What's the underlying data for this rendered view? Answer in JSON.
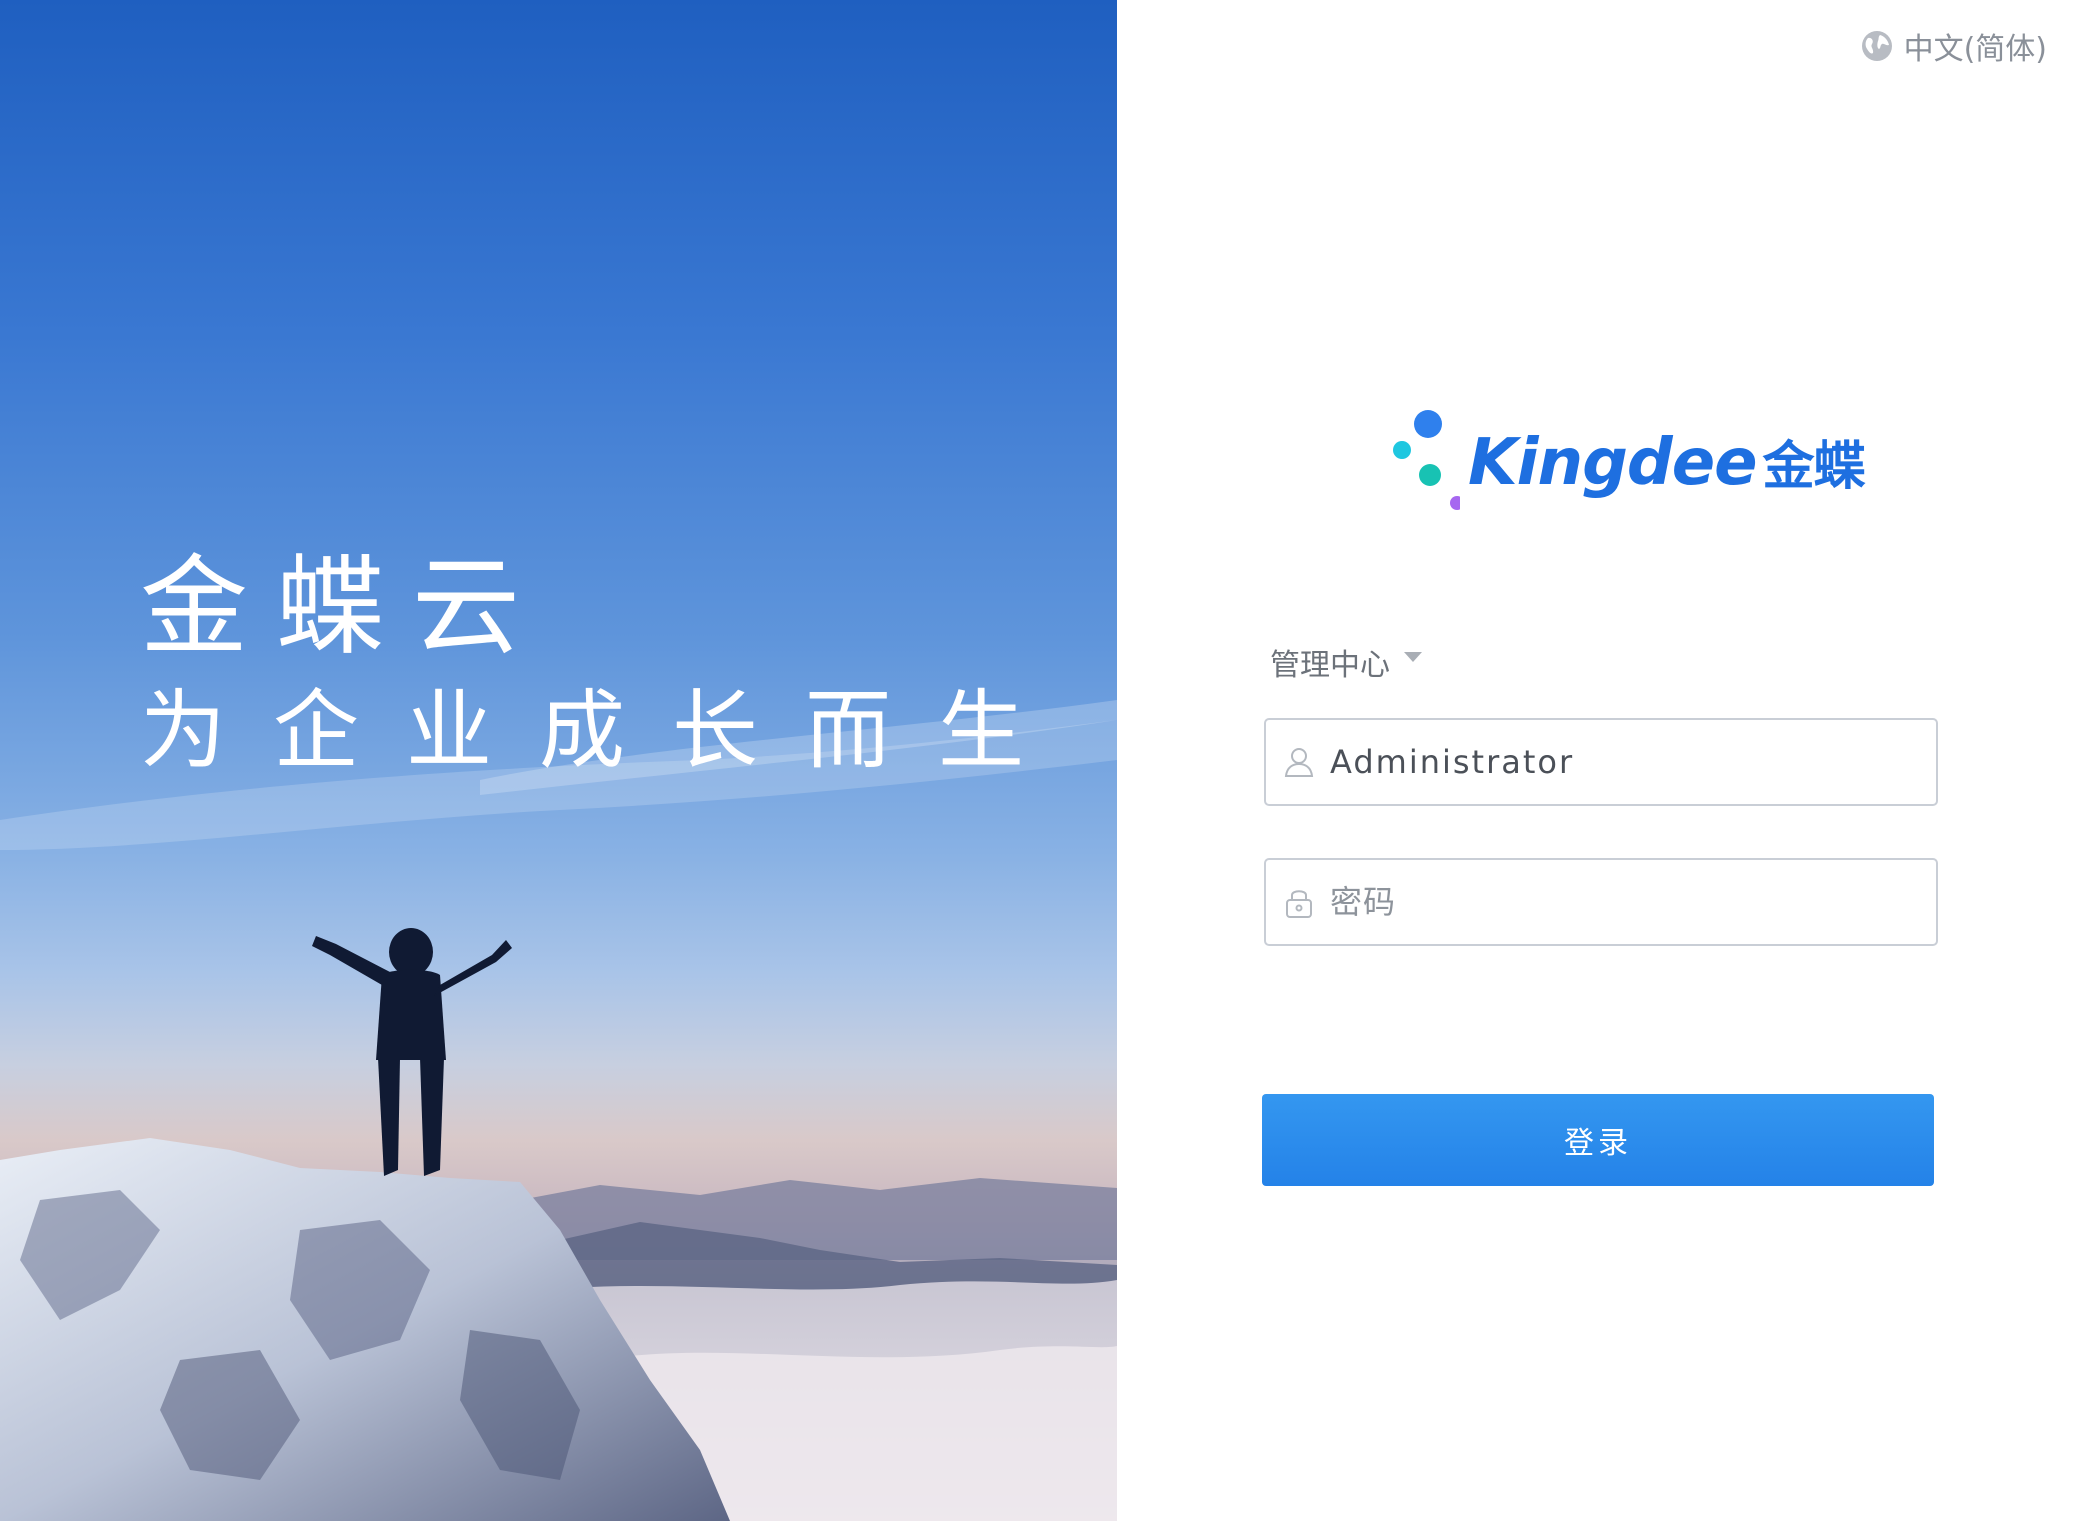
{
  "hero": {
    "title": "金蝶云",
    "subtitle": "为企业成长而生"
  },
  "language": {
    "label": "中文(简体)",
    "icon": "globe-icon"
  },
  "logo": {
    "brand": "Kingdee",
    "brand_cn": "金蝶",
    "dot_colors": [
      "#2f80ed",
      "#1fc7e0",
      "#18c2b3",
      "#a667f0"
    ]
  },
  "login": {
    "center_label": "管理中心",
    "username_value": "Administrator",
    "password_placeholder": "密码",
    "submit_label": "登录",
    "user_icon": "user-icon",
    "lock_icon": "lock-icon"
  },
  "colors": {
    "accent": "#2a8aeb",
    "border": "#c9ced6",
    "muted_text": "#8a9099"
  }
}
